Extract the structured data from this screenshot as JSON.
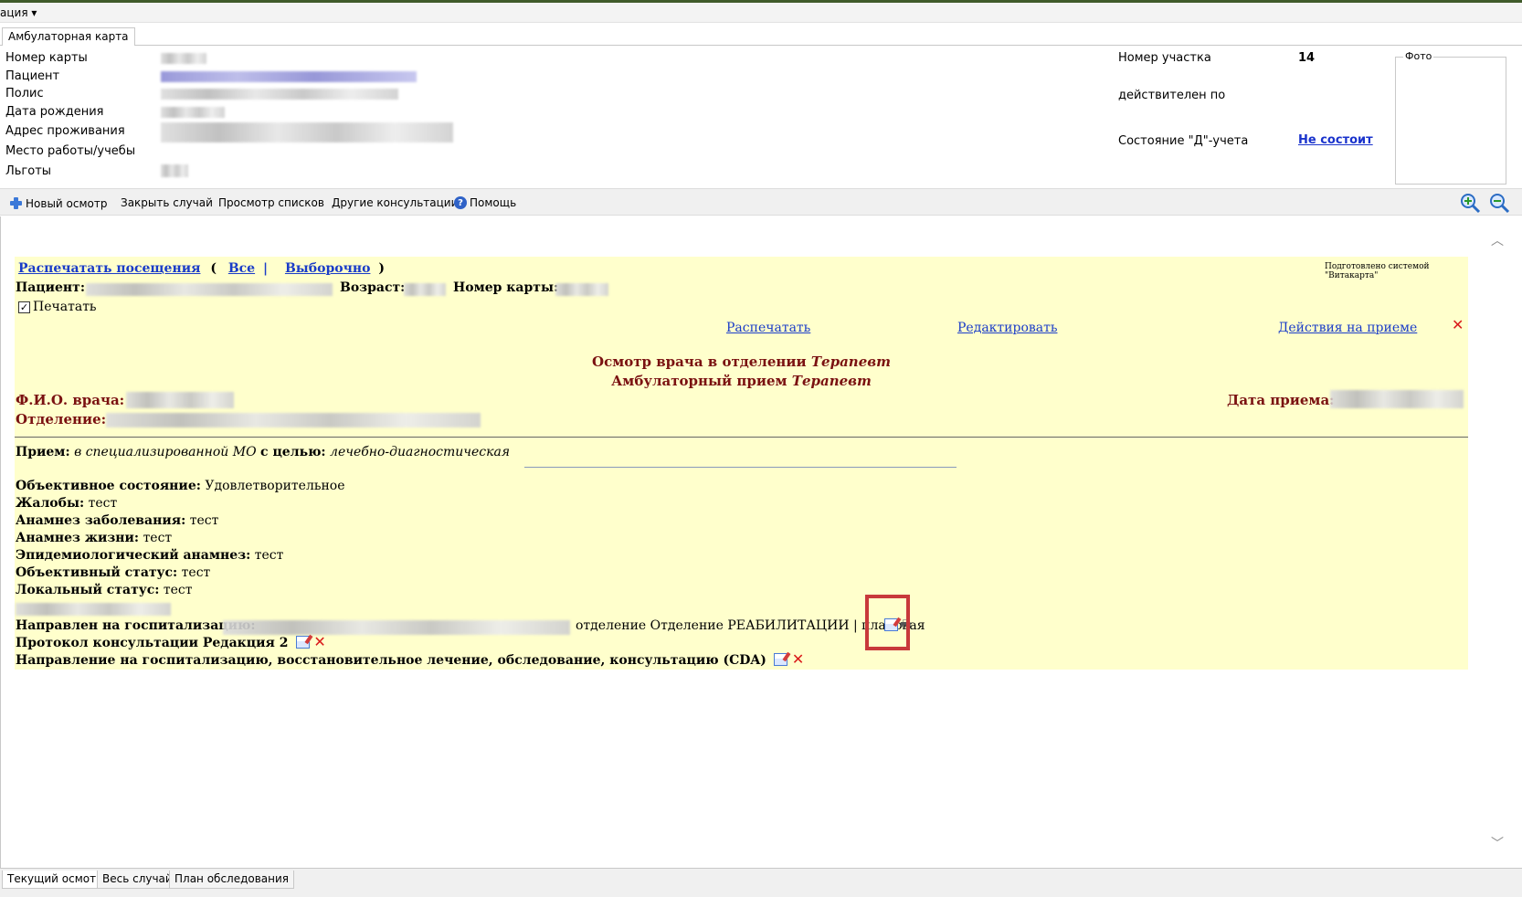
{
  "menubar": {
    "label": "ация"
  },
  "tabs": [
    {
      "label": "Амбулаторная карта"
    }
  ],
  "patient_header": {
    "labels": {
      "card_number": "Номер карты",
      "patient": "Пациент",
      "policy": "Полис",
      "birth_date": "Дата рождения",
      "address": "Адрес проживания",
      "workplace": "Место работы/учебы",
      "benefits": "Льготы"
    },
    "right": {
      "district_label": "Номер участка",
      "district_value": "14",
      "valid_until_label": "действителен по",
      "d_status_label": "Состояние \"Д\"-учета",
      "d_status_value": "Не состоит"
    },
    "photo_label": "Фото"
  },
  "toolbar": {
    "new_exam": "Новый осмотр",
    "close_case": "Закрыть случай",
    "view_lists": "Просмотр списков",
    "other_consultations": "Другие консультации",
    "help": "Помощь"
  },
  "document": {
    "print_visits": "Распечатать посещения",
    "paren_open": "(",
    "all": "Все",
    "separator": "|",
    "selective": "Выборочно",
    "paren_close": ")",
    "system_note": "Подготовлено системой \"Витакарта\"",
    "patient_label": "Пациент:",
    "age_label": "Возраст:",
    "card_label": "Номер карты:",
    "print_checkbox": "Печатать",
    "actions": {
      "print": "Распечатать",
      "edit": "Редактировать",
      "reception_actions": "Действия на приеме"
    },
    "title_line1_prefix": "Осмотр врача в отделении ",
    "title_line1_spec": "Терапевт",
    "title_line2_prefix": "Амбулаторный прием ",
    "title_line2_spec": "Терапевт",
    "doctor_label": "Ф.И.О. врача:",
    "department_label": "Отделение:",
    "reception_date_label": "Дата приема:",
    "reception": {
      "label": "Прием:",
      "place": "в специализированной МО",
      "goal_label": "с целью:",
      "goal": "лечебно-диагностическая"
    },
    "fields": [
      {
        "label": "Объективное состояние:",
        "value": "Удовлетворительное"
      },
      {
        "label": "Жалобы:",
        "value": "тест"
      },
      {
        "label": "Анамнез заболевания:",
        "value": "тест"
      },
      {
        "label": "Анамнез жизни:",
        "value": "тест"
      },
      {
        "label": "Эпидемиологический анамнез:",
        "value": "тест"
      },
      {
        "label": "Объективный статус:",
        "value": "тест"
      },
      {
        "label": "Локальный статус:",
        "value": "тест"
      }
    ],
    "hospitalization_label": "Направлен на госпитализацию:",
    "hospitalization_dept": "отделение Отделение РЕАБИЛИТАЦИИ | плановая",
    "protocol_label": "Протокол консультации Редакция 2",
    "referral_label": "Направление на госпитализацию, восстановительное лечение, обследование, консультацию (CDA)"
  },
  "bottom_tabs": [
    {
      "label": "Текущий осмотр"
    },
    {
      "label": "Весь случай"
    },
    {
      "label": "План обследования"
    }
  ]
}
